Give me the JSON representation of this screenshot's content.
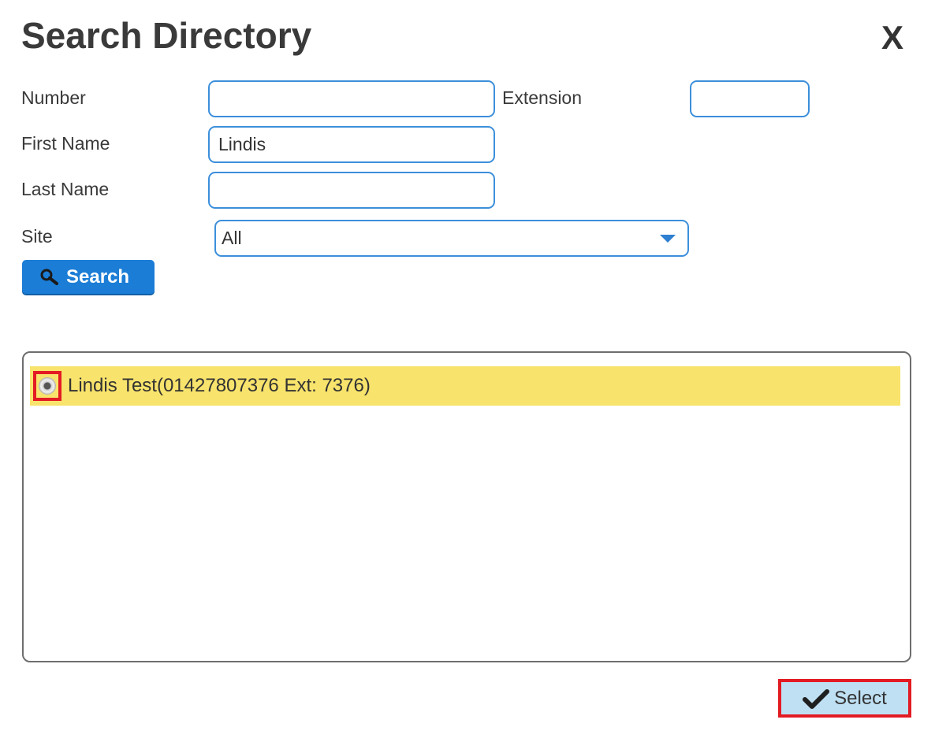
{
  "dialog": {
    "title": "Search Directory",
    "close_label": "X"
  },
  "form": {
    "number": {
      "label": "Number",
      "value": ""
    },
    "extension": {
      "label": "Extension",
      "value": ""
    },
    "first_name": {
      "label": "First Name",
      "value": "Lindis"
    },
    "last_name": {
      "label": "Last Name",
      "value": ""
    },
    "site": {
      "label": "Site",
      "selected": "All"
    },
    "search_button": {
      "label": "Search",
      "icon": "search-icon"
    }
  },
  "results": {
    "items": [
      {
        "text": "Lindis Test(01427807376 Ext: 7376)",
        "selected": true
      }
    ]
  },
  "footer": {
    "select_button": {
      "label": "Select",
      "icon": "checkmark-icon"
    }
  },
  "colors": {
    "accent_blue": "#1b7dd6",
    "input_border": "#3c8fdb",
    "highlight_row": "#f8e36c",
    "annotation_red": "#e31b23",
    "select_button_bg": "#bfe0f3"
  }
}
